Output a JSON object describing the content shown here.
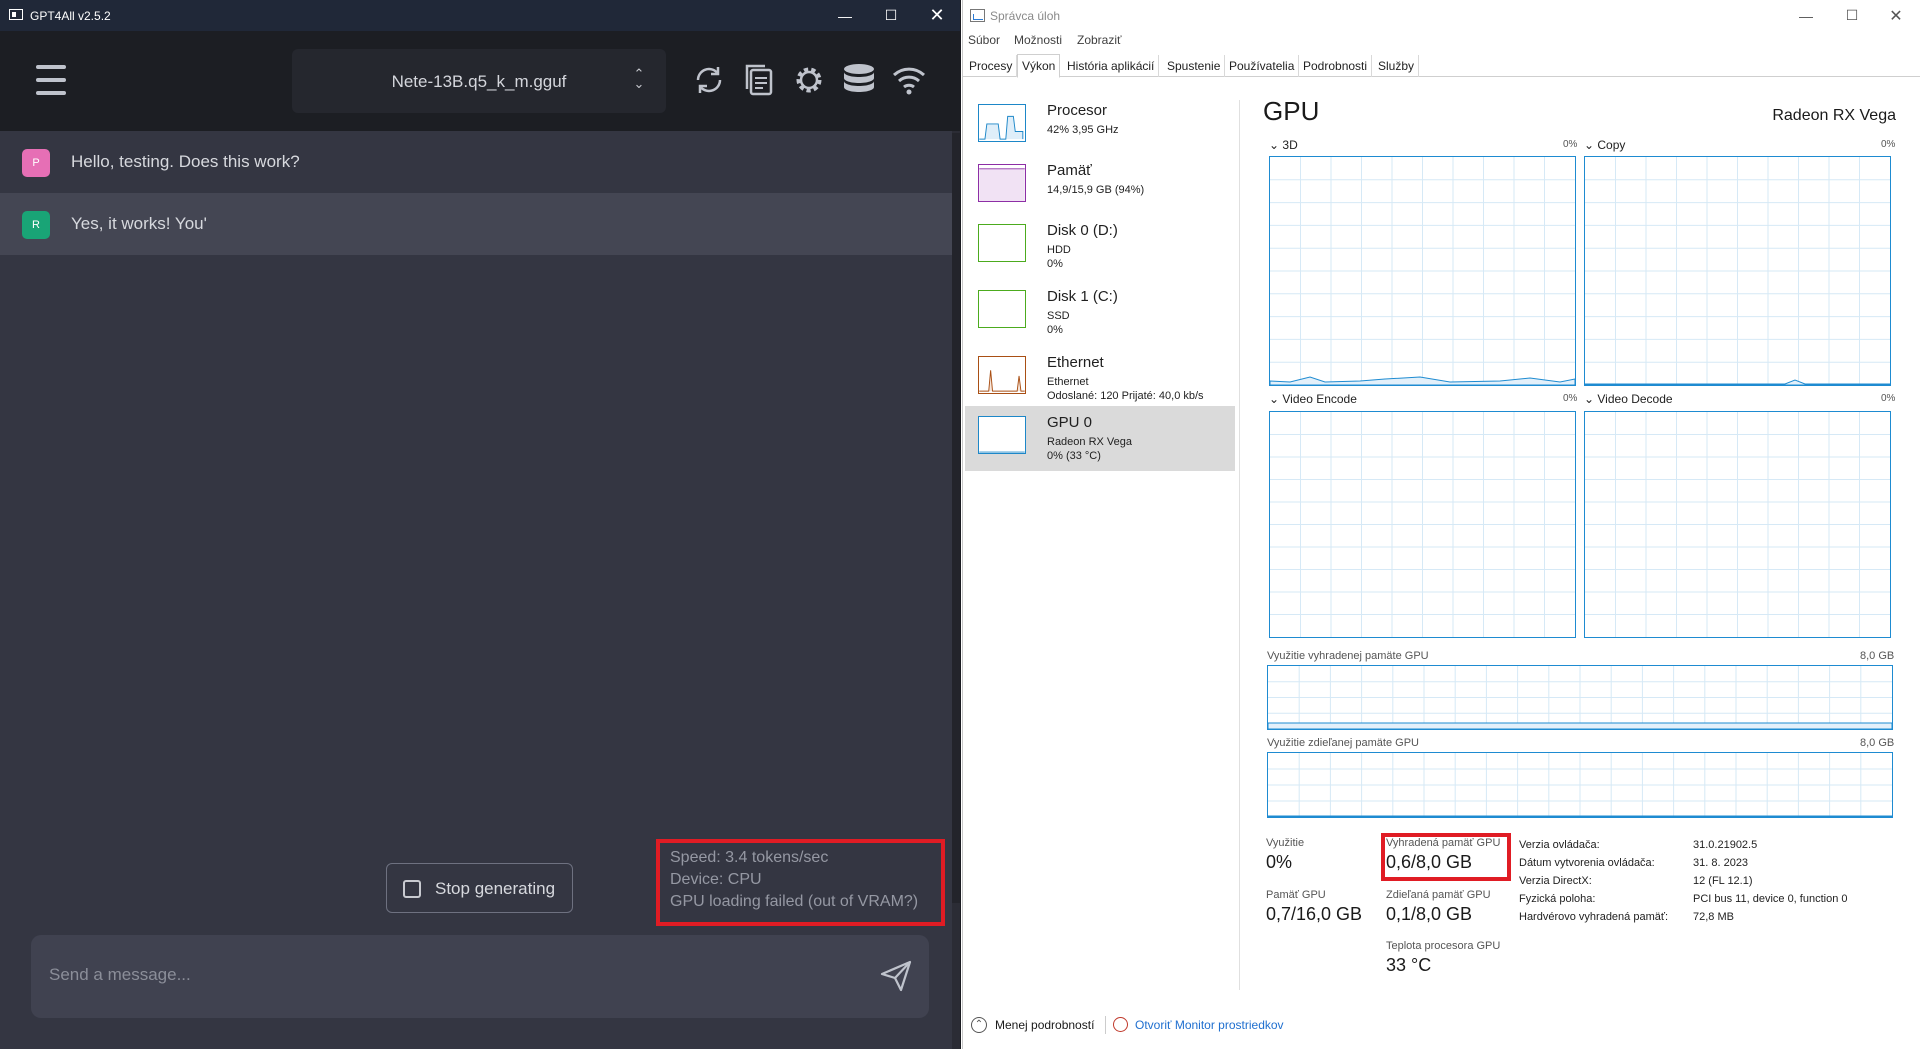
{
  "gpt4all": {
    "window_title": "GPT4All v2.5.2",
    "model_selector": "Nete-13B.q5_k_m.gguf",
    "messages": [
      {
        "avatar": "P",
        "text": "Hello, testing. Does this work?",
        "color": "#e66fb5"
      },
      {
        "avatar": "R",
        "text": "Yes, it works! You'",
        "color": "#19a476"
      }
    ],
    "stop_button_label": "Stop generating",
    "status": {
      "speed": "Speed: 3.4 tokens/sec",
      "device": "Device: CPU",
      "gpu_msg": "GPU loading failed (out of VRAM?)"
    },
    "input_placeholder": "Send a message...",
    "header_icons": [
      "refresh-icon",
      "copy-icon",
      "settings-icon",
      "database-icon",
      "wifi-icon"
    ]
  },
  "taskmgr": {
    "window_title": "Správca úloh",
    "menu": [
      "Súbor",
      "Možnosti",
      "Zobraziť"
    ],
    "tabs": [
      "Procesy",
      "Výkon",
      "História aplikácií",
      "Spustenie",
      "Používatelia",
      "Podrobnosti",
      "Služby"
    ],
    "active_tab": "Výkon",
    "sidebar": [
      {
        "name": "Procesor",
        "sub1": "42% 3,95 GHz",
        "sub2": "",
        "color": "#1d87c8"
      },
      {
        "name": "Pamäť",
        "sub1": "14,9/15,9 GB (94%)",
        "sub2": "",
        "color": "#8d2ea6"
      },
      {
        "name": "Disk 0 (D:)",
        "sub1": "HDD",
        "sub2": "0%",
        "color": "#4cab1e"
      },
      {
        "name": "Disk 1 (C:)",
        "sub1": "SSD",
        "sub2": "0%",
        "color": "#4cab1e"
      },
      {
        "name": "Ethernet",
        "sub1": "Ethernet",
        "sub2": "Odoslané: 120 Prijaté: 40,0 kb/s",
        "color": "#a94f14"
      },
      {
        "name": "GPU 0",
        "sub1": "Radeon RX Vega",
        "sub2": "0% (33 °C)",
        "color": "#1d87c8"
      }
    ],
    "gpu": {
      "title": "GPU",
      "name": "Radeon RX Vega",
      "engines": [
        {
          "label": "3D",
          "pct": "0%"
        },
        {
          "label": "Copy",
          "pct": "0%"
        },
        {
          "label": "Video Encode",
          "pct": "0%"
        },
        {
          "label": "Video Decode",
          "pct": "0%"
        }
      ],
      "dedicated_label": "Využitie vyhradenej pamäte GPU",
      "dedicated_max": "8,0 GB",
      "shared_label": "Využitie zdieľanej pamäte GPU",
      "shared_max": "8,0 GB",
      "stats": {
        "util_label": "Využitie",
        "util_value": "0%",
        "ded_label": "Vyhradená pamäť GPU",
        "ded_value": "0,6/8,0 GB",
        "gpu_mem_label": "Pamäť GPU",
        "gpu_mem_value": "0,7/16,0 GB",
        "shared_label": "Zdieľaná pamäť GPU",
        "shared_value": "0,1/8,0 GB",
        "temp_label": "Teplota procesora GPU",
        "temp_value": "33 °C"
      },
      "info": [
        {
          "k": "Verzia ovládača:",
          "v": "31.0.21902.5"
        },
        {
          "k": "Dátum vytvorenia ovládača:",
          "v": "31. 8. 2023"
        },
        {
          "k": "Verzia DirectX:",
          "v": "12 (FL 12.1)"
        },
        {
          "k": "Fyzická poloha:",
          "v": "PCI bus 11, device 0, function 0"
        },
        {
          "k": "Hardvérovo vyhradená pamäť:",
          "v": "72,8 MB"
        }
      ]
    },
    "footer": {
      "less_details": "Menej podrobností",
      "resource_monitor": "Otvoriť Monitor prostriedkov"
    }
  }
}
